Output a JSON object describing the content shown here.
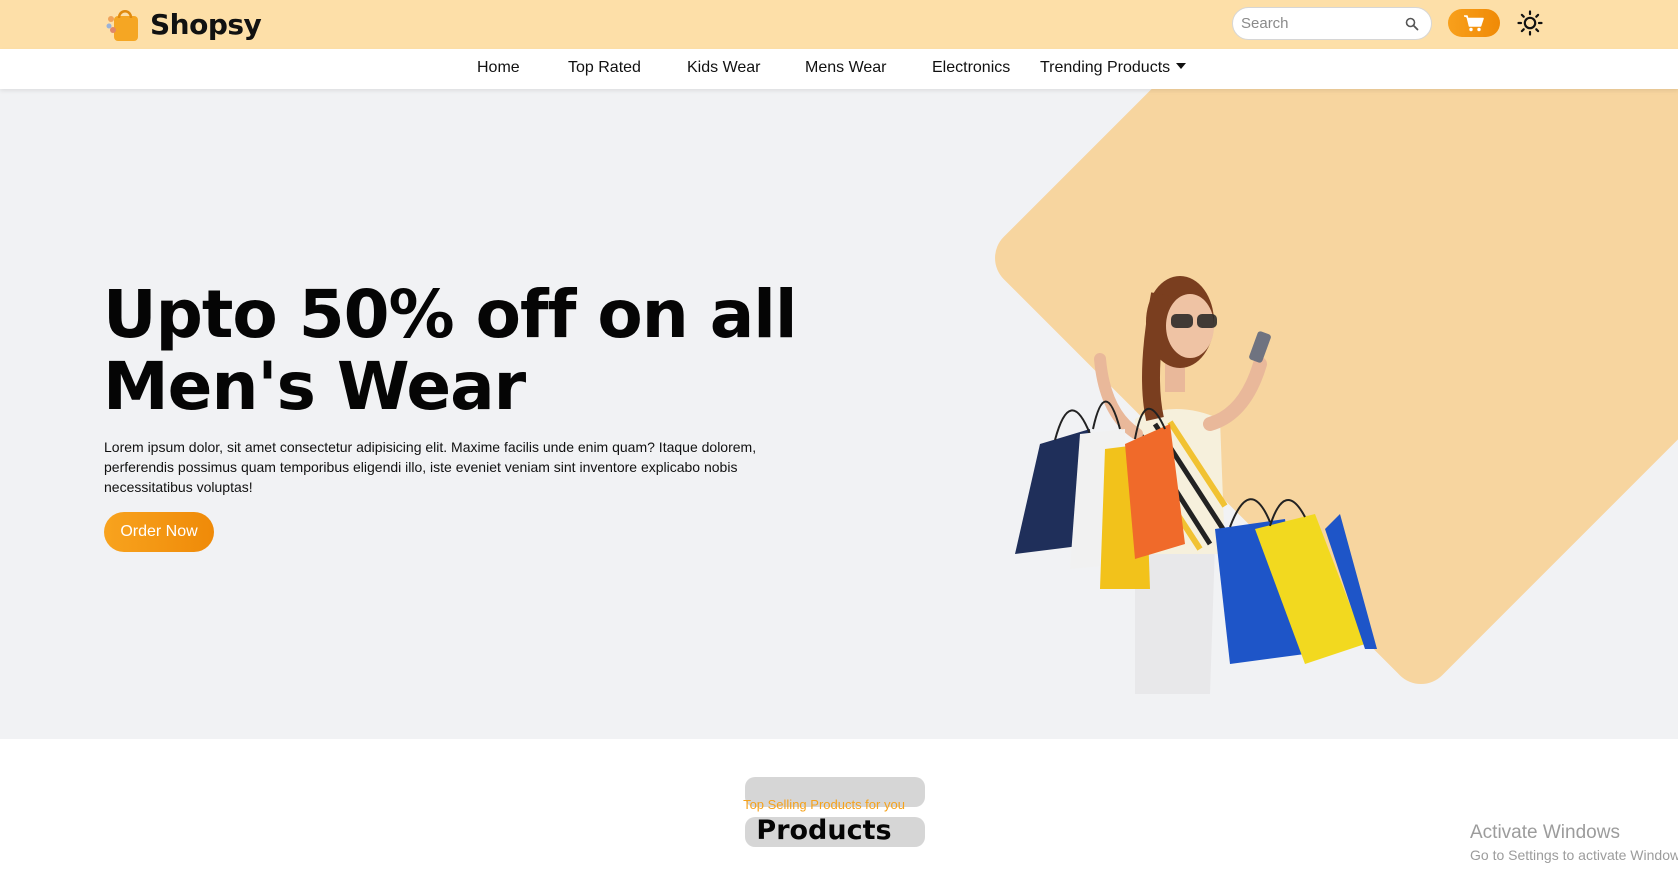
{
  "header": {
    "brand_name": "Shopsy",
    "search_placeholder": "Search",
    "accent_color": "#f59e0b"
  },
  "nav": {
    "items": [
      {
        "label": "Home"
      },
      {
        "label": "Top Rated"
      },
      {
        "label": "Kids Wear"
      },
      {
        "label": "Mens Wear"
      },
      {
        "label": "Electronics"
      },
      {
        "label": "Trending Products"
      }
    ]
  },
  "hero": {
    "title_line1": "Upto 50% off on all",
    "title_line2": "Men's Wear",
    "description": "Lorem ipsum dolor, sit amet consectetur adipisicing elit. Maxime facilis unde enim quam? Itaque dolorem, perferendis possimus quam temporibus eligendi illo, iste eveniet veniam sint inventore explicabo nobis necessitatibus voluptas!",
    "cta_label": "Order Now"
  },
  "products": {
    "subtitle": "Top Selling Products for you",
    "title": "Products"
  },
  "os_overlay": {
    "line1": "Activate Windows",
    "line2": "Go to Settings to activate Windows."
  }
}
